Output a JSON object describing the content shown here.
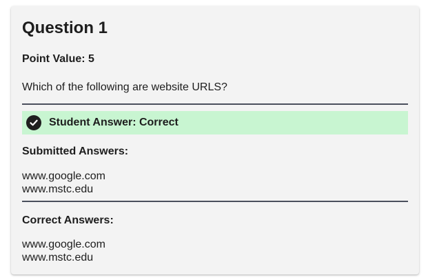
{
  "question": {
    "title": "Question 1",
    "point_value": "Point Value: 5",
    "prompt": "Which of the following are website URLS?"
  },
  "result": {
    "icon": "check-circle-icon",
    "text": "Student Answer: Correct",
    "banner_color": "#c8f5d1"
  },
  "submitted": {
    "label": "Submitted Answers:",
    "answers": [
      "www.google.com",
      "www.mstc.edu"
    ]
  },
  "correct": {
    "label": "Correct Answers:",
    "answers": [
      "www.google.com",
      "www.mstc.edu"
    ]
  }
}
